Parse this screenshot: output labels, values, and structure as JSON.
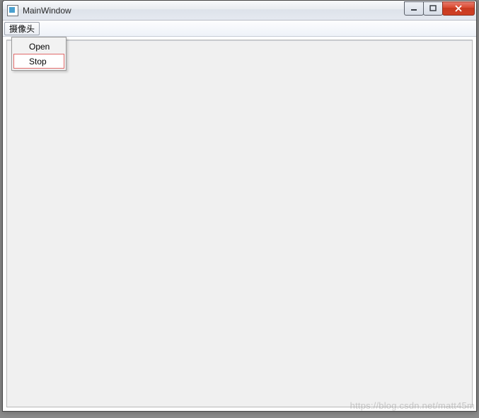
{
  "window": {
    "title": "MainWindow"
  },
  "menu": {
    "camera_label": "摄像头",
    "items": {
      "open": "Open",
      "stop": "Stop"
    }
  },
  "watermark": "https://blog.csdn.net/matt45m"
}
